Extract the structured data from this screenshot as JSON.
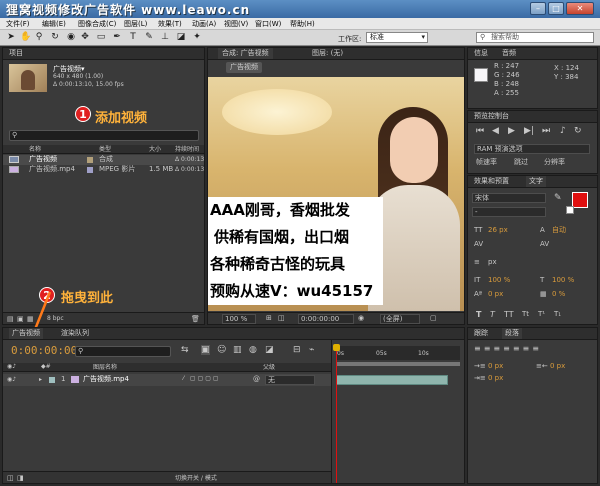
{
  "title_bar": {
    "title": "狸窝视频修改广告软件 www.leawo.cn"
  },
  "menu": [
    "文件(F)",
    "编辑(E)",
    "图像合成(C)",
    "图层(L)",
    "效果(T)",
    "动画(A)",
    "视图(V)",
    "窗口(W)",
    "帮助(H)"
  ],
  "toolbar": {
    "workspace_label": "工作区:",
    "workspace_value": "标准",
    "search_placeholder": "搜索帮助"
  },
  "project": {
    "tab": "项目",
    "thumb_name": "广告视频▾",
    "thumb_info": [
      "640 x 480 (1.00)",
      "Δ 0:00:13:10, 15.00 fps"
    ],
    "annotation_number": "1",
    "annotation_text": "添加视频",
    "columns": [
      "名称",
      "类型",
      "大小",
      "持续时间"
    ],
    "items": [
      {
        "name": "广告视频",
        "type": "合成",
        "size": "",
        "duration": "Δ 0:00:13"
      },
      {
        "name": "广告视频.mp4",
        "type": "MPEG 影片",
        "size": "1.5 MB",
        "duration": "Δ 0:00:13"
      }
    ],
    "bpc": "8 bpc"
  },
  "composition": {
    "tab": "合成: 广告视频",
    "tab2": "图层: (无)",
    "sub_tab": "广告视频",
    "overlay_lines": [
      "AAA刚哥，香烟批发",
      "供稀有国烟，出口烟",
      "各种稀奇古怪的玩具",
      "预购从速V：wu45157"
    ],
    "zoom": "100 %",
    "timecode": "0:00:00:00",
    "quality": "(全屏)"
  },
  "info": {
    "tabs": [
      "信息",
      "音频"
    ],
    "rgba": [
      "R : 247",
      "G : 246",
      "B : 248",
      "A : 255"
    ],
    "xy": [
      "X : 124",
      "Y : 384"
    ],
    "swatch_color": "#f7f6f8"
  },
  "preview": {
    "tab": "预览控制台",
    "ram_label": "RAM 预演选项",
    "labels": [
      "帧速率",
      "跳过",
      "分辨率"
    ]
  },
  "effects": {
    "tabs": [
      "效果和预置",
      "文字"
    ]
  },
  "text_panel": {
    "font": "宋体",
    "size": "26 px",
    "auto_label": "自动",
    "px_label": "px",
    "percents": [
      "100 %",
      "100 %"
    ],
    "zero_px": "0 px",
    "zero_pct": "0 %"
  },
  "timeline": {
    "tabs": [
      "广告视频",
      "渲染队列"
    ],
    "timecode": "0:00:00:00",
    "search_placeholder": "",
    "layer_col": "图层名称",
    "parent_col": "父级",
    "layer": {
      "index": "1",
      "name": "广告视频.mp4",
      "parent": "无"
    },
    "ruler": [
      "0s",
      "05s",
      "10s"
    ],
    "toggle_label": "切换开关 / 模式",
    "annotation_number": "2",
    "annotation_text": "拖曳到此"
  },
  "tracker": {
    "tabs": [
      "跟踪",
      "段落"
    ],
    "px": [
      "0 px",
      "0 px",
      "0 px"
    ]
  }
}
